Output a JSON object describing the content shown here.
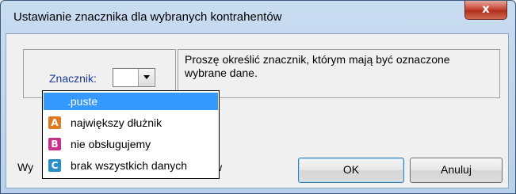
{
  "window": {
    "title": "Ustawianie znacznika dla wybranych kontrahentów",
    "close_glyph": "x"
  },
  "marker": {
    "label": "Znacznik:",
    "value": ""
  },
  "info": {
    "text": "Proszę określić znacznik, którym mają być oznaczone wybrane dane."
  },
  "bottom": {
    "partial_left": "Wy",
    "partial_right": "w"
  },
  "buttons": {
    "ok": "OK",
    "cancel": "Anuluj"
  },
  "dropdown": {
    "items": [
      {
        "label": ".puste",
        "badge": "",
        "color": ""
      },
      {
        "label": "największy dłużnik",
        "badge": "A",
        "color": "#e07a1f"
      },
      {
        "label": "nie obsługujemy",
        "badge": "B",
        "color": "#c8308c"
      },
      {
        "label": "brak wszystkich danych",
        "badge": "C",
        "color": "#2a8fc6"
      }
    ],
    "selected": ".puste"
  }
}
